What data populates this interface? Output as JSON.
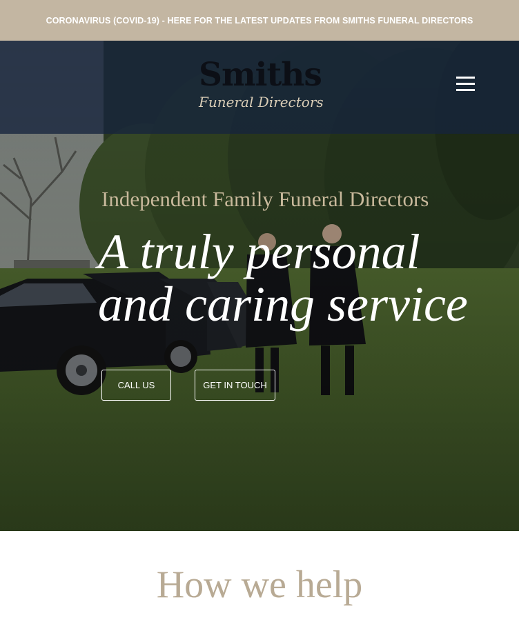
{
  "alert": {
    "text": "CORONAVIRUS (COVID-19) - HERE FOR THE LATEST UPDATES FROM SMITHS FUNERAL DIRECTORS"
  },
  "header": {
    "logo_main": "Smiths",
    "logo_sub": "Funeral Directors",
    "menu_icon": "hamburger-menu-icon"
  },
  "hero": {
    "eyebrow": "Independent Family Funeral Directors",
    "headline_line1": "A truly personal",
    "headline_line2": "and caring service",
    "buttons": {
      "call": "CALL US",
      "contact": "GET IN TOUCH"
    }
  },
  "section": {
    "title": "How we help"
  },
  "colors": {
    "alert_bg": "#c3b6a2",
    "header_overlay": "#16243c",
    "eyebrow": "#c9b99c",
    "section_title": "#b8aa94"
  }
}
